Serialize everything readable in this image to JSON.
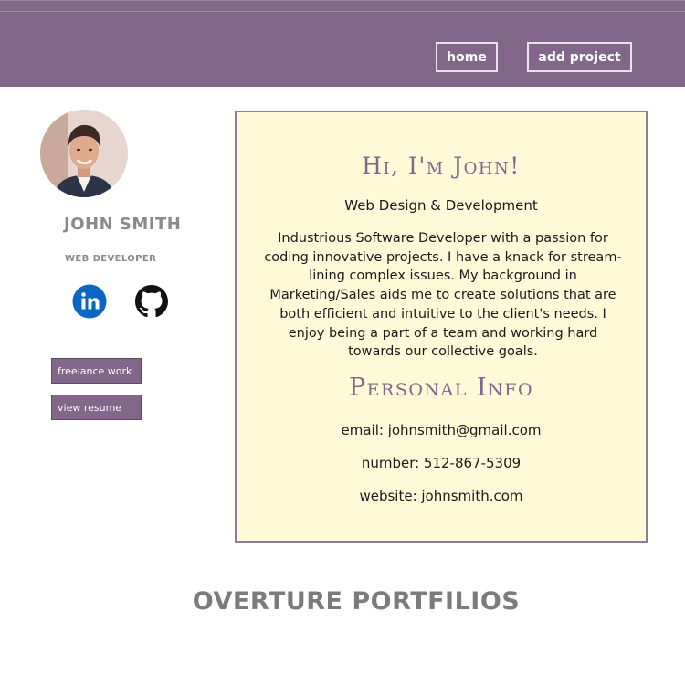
{
  "nav": {
    "home_label": "home",
    "add_project_label": "add project"
  },
  "profile": {
    "name": "JOHN SMITH",
    "title": "WEB DEVELOPER",
    "social": [
      "linkedin-icon",
      "github-icon"
    ]
  },
  "sidebar_buttons": {
    "freelance_label": "freelance work",
    "resume_label": "view resume"
  },
  "card": {
    "greeting": "Hi, I'm John!",
    "subtitle": "Web Design & Development",
    "bio": "Industrious Software Developer with a passion for coding innovative projects. I have a knack for stream-lining complex issues. My background in Marketing/Sales aids me to create solutions that are both efficient and intuitive to the client's needs. I enjoy being a part of a team and working hard towards our collective goals.",
    "info_heading": "Personal Info",
    "email": "email: johnsmith@gmail.com",
    "number": "number: 512-867-5309",
    "website": "website: johnsmith.com"
  },
  "section": {
    "title": "OVERTURE PORTFILIOS"
  },
  "colors": {
    "accent": "#83678b",
    "card_bg": "#fef9d7",
    "muted_text": "#8a8a8a",
    "linkedin": "#0a66c2"
  }
}
